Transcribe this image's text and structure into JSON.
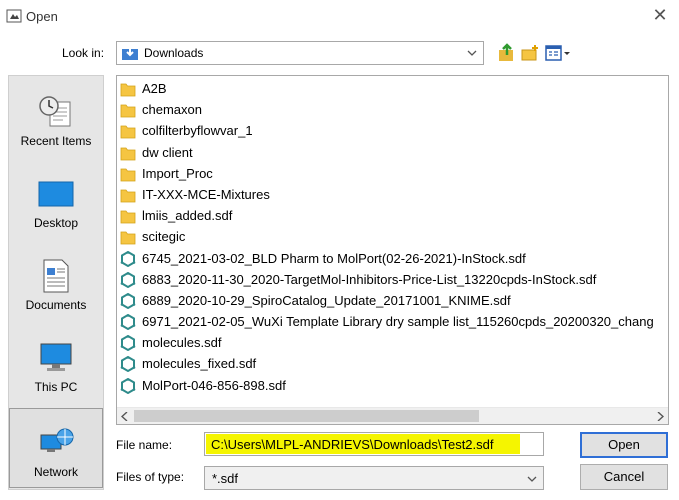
{
  "window": {
    "title": "Open",
    "close_label": "✕"
  },
  "toolbar": {
    "look_in_label": "Look in:",
    "look_in_value": "Downloads"
  },
  "places": [
    {
      "label": "Recent Items",
      "icon": "recent-items-icon"
    },
    {
      "label": "Desktop",
      "icon": "desktop-icon"
    },
    {
      "label": "Documents",
      "icon": "documents-icon"
    },
    {
      "label": "This PC",
      "icon": "this-pc-icon"
    },
    {
      "label": "Network",
      "icon": "network-icon"
    }
  ],
  "files": [
    {
      "name": "A2B",
      "type": "folder"
    },
    {
      "name": "chemaxon",
      "type": "folder"
    },
    {
      "name": "colfilterbyflowvar_1",
      "type": "folder"
    },
    {
      "name": "dw client",
      "type": "folder"
    },
    {
      "name": "Import_Proc",
      "type": "folder"
    },
    {
      "name": "IT-XXX-MCE-Mixtures",
      "type": "folder"
    },
    {
      "name": "lmiis_added.sdf",
      "type": "folder"
    },
    {
      "name": "scitegic",
      "type": "folder"
    },
    {
      "name": "6745_2021-03-02_BLD Pharm to MolPort(02-26-2021)-InStock.sdf",
      "type": "sdf"
    },
    {
      "name": "6883_2020-11-30_2020-TargetMol-Inhibitors-Price-List_13220cpds-InStock.sdf",
      "type": "sdf"
    },
    {
      "name": "6889_2020-10-29_SpiroCatalog_Update_20171001_KNIME.sdf",
      "type": "sdf"
    },
    {
      "name": "6971_2021-02-05_WuXi Template Library dry sample list_115260cpds_20200320_chang",
      "type": "sdf"
    },
    {
      "name": "molecules.sdf",
      "type": "sdf"
    },
    {
      "name": "molecules_fixed.sdf",
      "type": "sdf"
    },
    {
      "name": "MolPort-046-856-898.sdf",
      "type": "sdf"
    }
  ],
  "form": {
    "file_name_label": "File name:",
    "file_name_value": "C:\\Users\\MLPL-ANDRIEVS\\Downloads\\Test2.sdf",
    "files_of_type_label": "Files of type:",
    "files_of_type_value": "*.sdf"
  },
  "buttons": {
    "open": "Open",
    "cancel": "Cancel"
  },
  "colors": {
    "highlight": "#f5f500",
    "folder": "#f5c542",
    "sdf_icon": "#2e8b8b",
    "default_button_border": "#2f6fd6"
  }
}
